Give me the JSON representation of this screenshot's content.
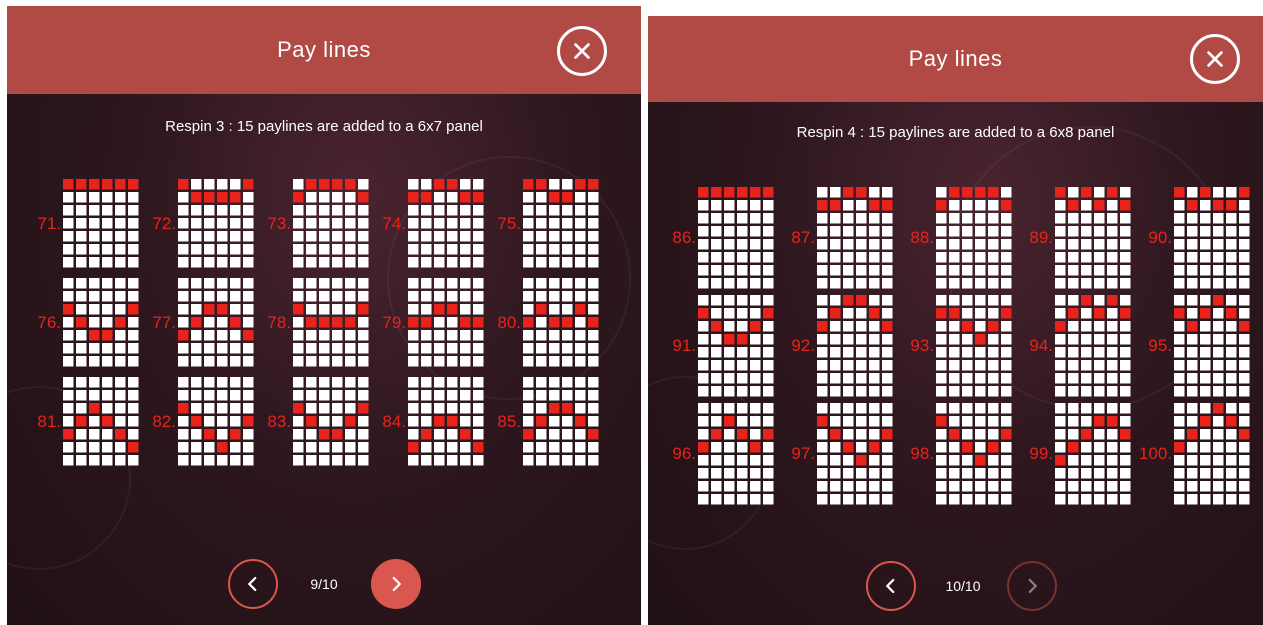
{
  "colors": {
    "header": "#b14a45",
    "accent": "#d9574e",
    "label": "#e8231c",
    "cell_white": "#ffffff",
    "cell_red": "#e8231c"
  },
  "left": {
    "title": "Pay lines",
    "close_icon": "close-icon",
    "subtitle": "Respin 3 : 15 paylines are added to a 6x7 panel",
    "grid_cols": 6,
    "grid_rows": 7,
    "paylines": [
      {
        "label": "71.",
        "path": [
          0,
          0,
          0,
          0,
          0,
          0
        ]
      },
      {
        "label": "72.",
        "path": [
          0,
          1,
          1,
          1,
          1,
          0
        ]
      },
      {
        "label": "73.",
        "path": [
          1,
          0,
          0,
          0,
          0,
          1
        ]
      },
      {
        "label": "74.",
        "path": [
          1,
          1,
          0,
          0,
          1,
          1
        ]
      },
      {
        "label": "75.",
        "path": [
          0,
          0,
          1,
          1,
          0,
          0
        ]
      },
      {
        "label": "76.",
        "path": [
          2,
          3,
          4,
          4,
          3,
          2
        ]
      },
      {
        "label": "77.",
        "path": [
          4,
          3,
          2,
          2,
          3,
          4
        ]
      },
      {
        "label": "78.",
        "path": [
          2,
          3,
          3,
          3,
          3,
          2
        ]
      },
      {
        "label": "79.",
        "path": [
          3,
          3,
          2,
          2,
          3,
          3
        ]
      },
      {
        "label": "80.",
        "path": [
          3,
          2,
          3,
          3,
          2,
          3
        ]
      },
      {
        "label": "81.",
        "path": [
          4,
          3,
          2,
          3,
          4,
          5
        ]
      },
      {
        "label": "82.",
        "path": [
          2,
          3,
          4,
          5,
          4,
          3
        ]
      },
      {
        "label": "83.",
        "path": [
          2,
          3,
          4,
          4,
          3,
          2
        ]
      },
      {
        "label": "84.",
        "path": [
          5,
          4,
          3,
          3,
          4,
          5
        ]
      },
      {
        "label": "85.",
        "path": [
          4,
          3,
          2,
          2,
          3,
          4
        ]
      }
    ],
    "pager": {
      "page": "9/10",
      "prev_icon": "chevron-left-icon",
      "next_icon": "chevron-right-icon",
      "next_enabled": true
    }
  },
  "right": {
    "title": "Pay lines",
    "close_icon": "close-icon",
    "subtitle": "Respin 4 : 15 paylines are added to a 6x8 panel",
    "grid_cols": 6,
    "grid_rows": 8,
    "paylines": [
      {
        "label": "86.",
        "path": [
          0,
          0,
          0,
          0,
          0,
          0
        ]
      },
      {
        "label": "87.",
        "path": [
          1,
          1,
          0,
          0,
          1,
          1
        ]
      },
      {
        "label": "88.",
        "path": [
          1,
          0,
          0,
          0,
          0,
          1
        ]
      },
      {
        "label": "89.",
        "path": [
          0,
          1,
          0,
          1,
          0,
          1
        ]
      },
      {
        "label": "90.",
        "path": [
          0,
          1,
          0,
          1,
          1,
          0
        ]
      },
      {
        "label": "91.",
        "path": [
          1,
          2,
          3,
          3,
          2,
          1
        ]
      },
      {
        "label": "92.",
        "path": [
          2,
          1,
          0,
          0,
          1,
          2
        ]
      },
      {
        "label": "93.",
        "path": [
          1,
          1,
          2,
          3,
          2,
          1
        ]
      },
      {
        "label": "94.",
        "path": [
          2,
          1,
          0,
          1,
          0,
          1
        ]
      },
      {
        "label": "95.",
        "path": [
          1,
          2,
          1,
          0,
          1,
          2
        ]
      },
      {
        "label": "96.",
        "path": [
          3,
          2,
          1,
          2,
          3,
          2
        ]
      },
      {
        "label": "97.",
        "path": [
          1,
          2,
          3,
          4,
          3,
          2
        ]
      },
      {
        "label": "98.",
        "path": [
          1,
          2,
          3,
          4,
          3,
          2
        ]
      },
      {
        "label": "99.",
        "path": [
          4,
          3,
          2,
          1,
          1,
          2
        ]
      },
      {
        "label": "100.",
        "path": [
          3,
          2,
          1,
          0,
          1,
          2
        ]
      }
    ],
    "pager": {
      "page": "10/10",
      "prev_icon": "chevron-left-icon",
      "next_icon": "chevron-right-icon",
      "next_enabled": false
    }
  }
}
